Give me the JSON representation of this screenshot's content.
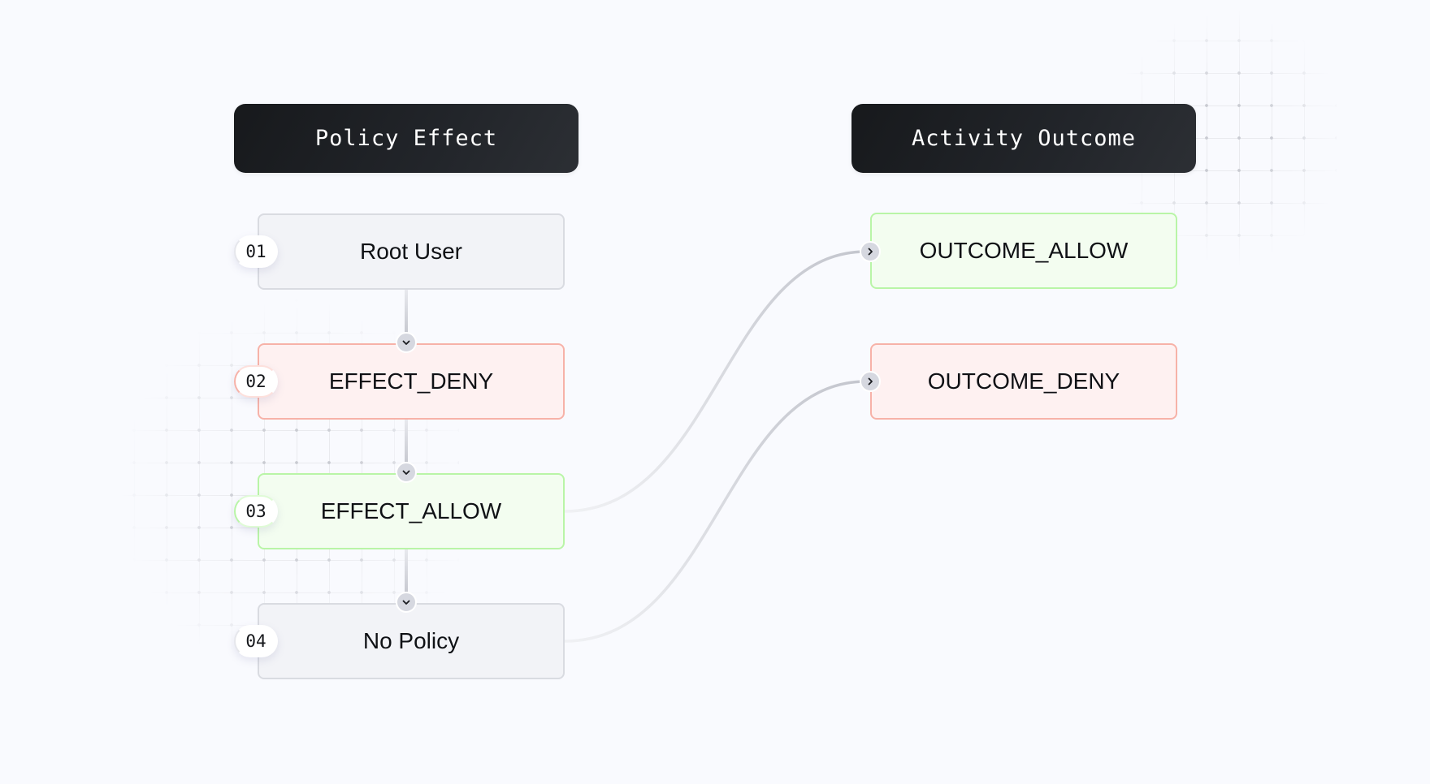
{
  "headers": {
    "left": "Policy Effect",
    "right": "Activity Outcome"
  },
  "policy_effects": [
    {
      "index": "01",
      "label": "Root User",
      "kind": "neutral"
    },
    {
      "index": "02",
      "label": "EFFECT_DENY",
      "kind": "deny"
    },
    {
      "index": "03",
      "label": "EFFECT_ALLOW",
      "kind": "allow"
    },
    {
      "index": "04",
      "label": "No Policy",
      "kind": "neutral"
    }
  ],
  "activity_outcomes": [
    {
      "label": "OUTCOME_ALLOW",
      "kind": "allow"
    },
    {
      "label": "OUTCOME_DENY",
      "kind": "deny"
    }
  ],
  "flow_edges": [
    {
      "from": "Root User",
      "to": "EFFECT_DENY",
      "type": "fallthrough"
    },
    {
      "from": "EFFECT_DENY",
      "to": "EFFECT_ALLOW",
      "type": "fallthrough"
    },
    {
      "from": "EFFECT_ALLOW",
      "to": "No Policy",
      "type": "fallthrough"
    }
  ],
  "outcome_edges": [
    {
      "from": "Root User",
      "to": "OUTCOME_ALLOW"
    },
    {
      "from": "EFFECT_DENY",
      "to": "OUTCOME_DENY"
    },
    {
      "from": "EFFECT_ALLOW",
      "to": "OUTCOME_ALLOW"
    },
    {
      "from": "No Policy",
      "to": "OUTCOME_DENY"
    }
  ],
  "icons": {
    "fallthrough": "chevron-down-icon",
    "outcome_input": "chevron-right-icon"
  },
  "colors": {
    "background": "#f9fafe",
    "header_bg": "#1b1d21",
    "neutral_fill": "#f2f3f7",
    "neutral_border": "#d9dbe1",
    "deny_fill": "#fef1f1",
    "deny_border": "#f7b2a8",
    "allow_fill": "#f3fdf0",
    "allow_border": "#b9f5a7",
    "wire": "#c4c6ce"
  }
}
